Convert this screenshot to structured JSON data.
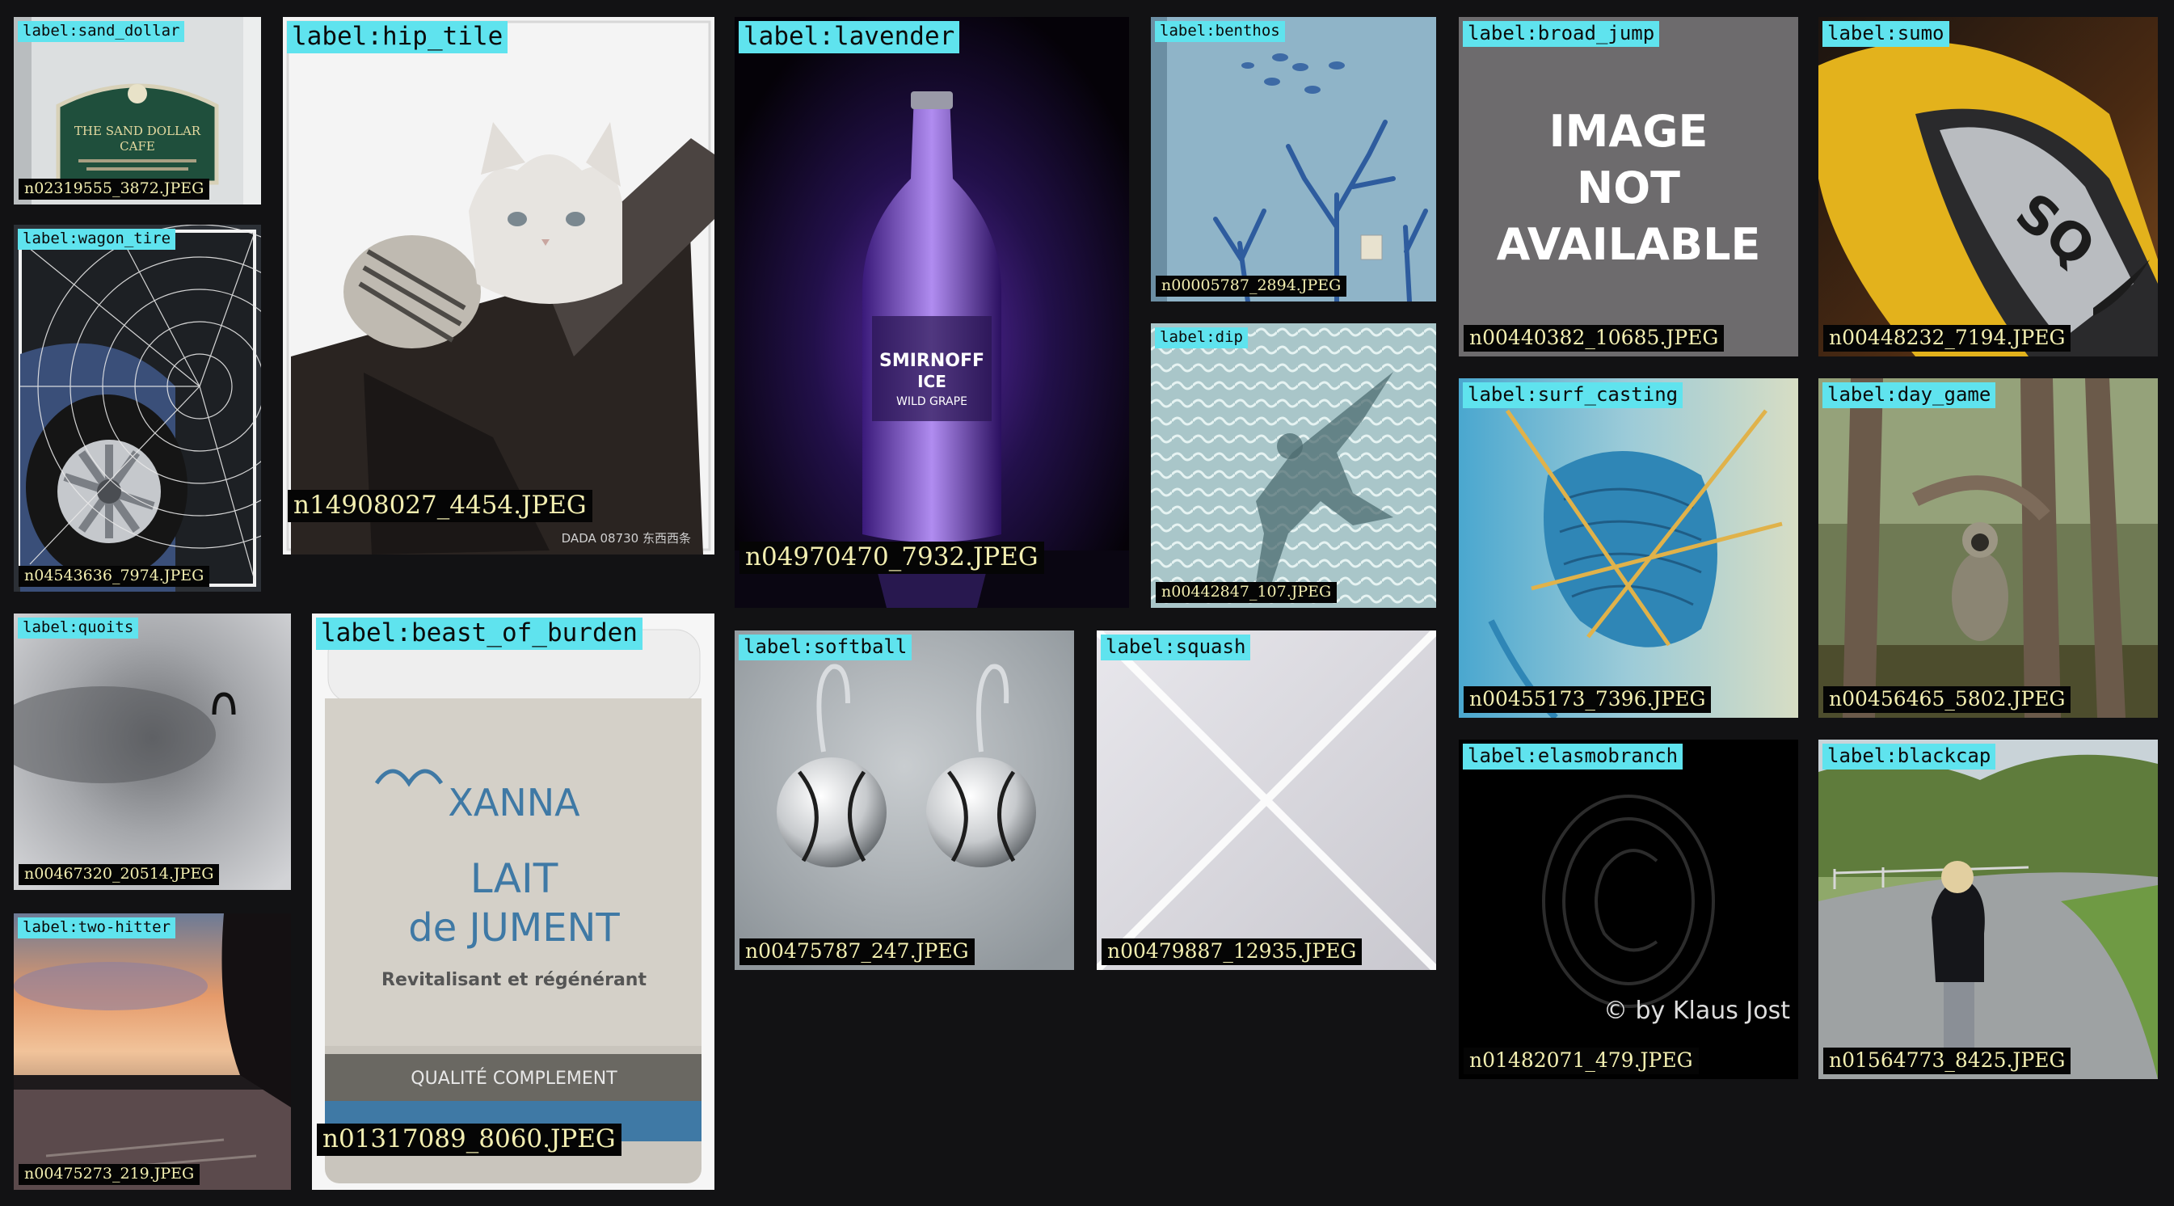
{
  "tiles": [
    {
      "label": "label:sand_dollar",
      "file": "n02319555_3872.JPEG",
      "art_text": [
        "THE SAND DOLLAR",
        "CAFE"
      ]
    },
    {
      "label": "label:wagon_tire",
      "file": "n04543636_7974.JPEG"
    },
    {
      "label": "label:hip_tile",
      "file": "n14908027_4454.JPEG",
      "art_text": [
        "DADA 08730 东西西条"
      ]
    },
    {
      "label": "label:lavender",
      "file": "n04970470_7932.JPEG",
      "art_text": [
        "SMIRNOFF",
        "ICE",
        "WILD GRAPE"
      ]
    },
    {
      "label": "label:benthos",
      "file": "n00005787_2894.JPEG"
    },
    {
      "label": "label:dip",
      "file": "n00442847_107.JPEG"
    },
    {
      "label": "label:broad_jump",
      "file": "n00440382_10685.JPEG",
      "art_text": [
        "IMAGE",
        "NOT",
        "AVAILABLE"
      ]
    },
    {
      "label": "label:sumo",
      "file": "n00448232_7194.JPEG",
      "art_text": [
        "SQ"
      ]
    },
    {
      "label": "label:surf_casting",
      "file": "n00455173_7396.JPEG"
    },
    {
      "label": "label:day_game",
      "file": "n00456465_5802.JPEG"
    },
    {
      "label": "label:quoits",
      "file": "n00467320_20514.JPEG"
    },
    {
      "label": "label:two-hitter",
      "file": "n00475273_219.JPEG"
    },
    {
      "label": "label:beast_of_burden",
      "file": "n01317089_8060.JPEG",
      "art_text": [
        "XANNA",
        "LAIT",
        "de JUMENT",
        "Revitalisant et régénérant",
        "QUALITÉ COMPLEMENT"
      ]
    },
    {
      "label": "label:softball",
      "file": "n00475787_247.JPEG"
    },
    {
      "label": "label:squash",
      "file": "n00479887_12935.JPEG"
    },
    {
      "label": "label:elasmobranch",
      "file": "n01482071_479.JPEG",
      "art_text": [
        "© by Klaus Jost"
      ]
    },
    {
      "label": "label:blackcap",
      "file": "n01564773_8425.JPEG"
    }
  ]
}
